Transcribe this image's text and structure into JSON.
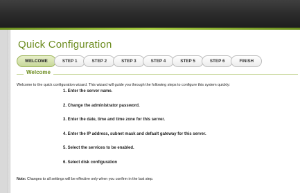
{
  "page": {
    "title": "Quick Configuration"
  },
  "wizard": {
    "steps": [
      "WELCOME",
      "STEP 1",
      "STEP 2",
      "STEP 3",
      "STEP 4",
      "STEP 5",
      "STEP 6",
      "FINISH"
    ],
    "active_step": "WELCOME"
  },
  "section": {
    "legend": "Welcome",
    "intro": "Welcome to the quick configuration wizard. This wizard will guide you through the following steps to configure this system quickly:",
    "items": [
      "1. Enter the server name.",
      "2. Change the administrator password.",
      "3. Enter the date, time and time zone for this server.",
      "4. Enter the IP address, subnet mask and default gateway for this server.",
      "5. Select the services to be enabled.",
      "6. Select disk configuration"
    ],
    "note_label": "Note:",
    "note_text": " Changes to all settings will be effective only when you confirm in the last step."
  },
  "colors": {
    "accent": "#6c8c1f",
    "active_step_bg": "#c7d89a",
    "topbar": "#2a2a2a"
  }
}
